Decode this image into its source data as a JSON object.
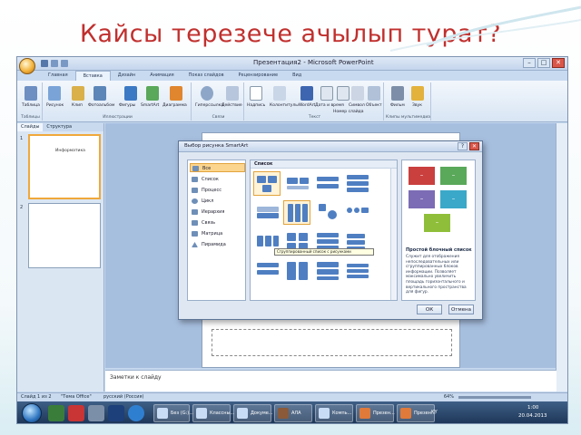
{
  "slide_title": "Кайсы терезече ачылып турат?",
  "app": {
    "window_title": "Презентация2 - Microsoft PowerPoint",
    "tabs": [
      "Главная",
      "Вставка",
      "Дизайн",
      "Анимация",
      "Показ слайдов",
      "Рецензирование",
      "Вид"
    ],
    "ribbon_groups": [
      {
        "name": "Таблицы",
        "buttons": [
          "Таблица"
        ]
      },
      {
        "name": "Иллюстрации",
        "buttons": [
          "Рисунок",
          "Клип",
          "Фотоальбом",
          "Фигуры",
          "SmartArt",
          "Диаграмма"
        ]
      },
      {
        "name": "Связи",
        "buttons": [
          "Гиперссылка",
          "Действие"
        ]
      },
      {
        "name": "Текст",
        "buttons": [
          "Надпись",
          "Колонтитулы",
          "WordArt",
          "Дата и время",
          "Номер слайда",
          "Символ",
          "Объект"
        ]
      },
      {
        "name": "Клипы мультимедиа",
        "buttons": [
          "Фильм",
          "Звук"
        ]
      }
    ],
    "left_tabs": [
      "Слайды",
      "Структура"
    ],
    "thumbnails": [
      {
        "num": "1",
        "text": "Информатика"
      },
      {
        "num": "2",
        "text": ""
      }
    ],
    "notes_placeholder": "Заметки к слайду",
    "status": {
      "slide": "Слайд 1 из 2",
      "theme": "\"Тема Office\"",
      "language": "русский (Россия)",
      "zoom": "64%"
    }
  },
  "dialog": {
    "title": "Выбор рисунка SmartArt",
    "categories": [
      "Все",
      "Список",
      "Процесс",
      "Цикл",
      "Иерархия",
      "Связь",
      "Матрица",
      "Пирамида"
    ],
    "selected_category": "Все",
    "gallery_header": "Список",
    "tooltip": "Сгруппированный список с рисунками",
    "preview_name": "Простой блочный список",
    "preview_description": "Служит для отображения непоследовательных или сгруппированных блоков информации. Позволяет максимально увеличить площадь горизонтального и вертикального пространства для фигур.",
    "ok_label": "ОК",
    "cancel_label": "Отмена"
  },
  "taskbar": {
    "tasks": [
      "Без (G:)...",
      "Классны...",
      "Докуме...",
      "АЛА",
      "Компь...",
      "Презен...",
      "Презен..."
    ],
    "lang": "KY",
    "time": "1:00",
    "date": "20.04.2013"
  },
  "colors": {
    "title_red": "#c0302e",
    "smartart_red": "#c9403e",
    "smartart_green": "#5aa85a",
    "smartart_purple": "#7c6cb5",
    "smartart_teal": "#3aa8c8",
    "smartart_olive": "#8fbf3a",
    "selection_orange": "#f0a83a"
  },
  "icons": [
    "office-button-icon",
    "start-orb-icon",
    "smartart-icon",
    "close-icon"
  ]
}
